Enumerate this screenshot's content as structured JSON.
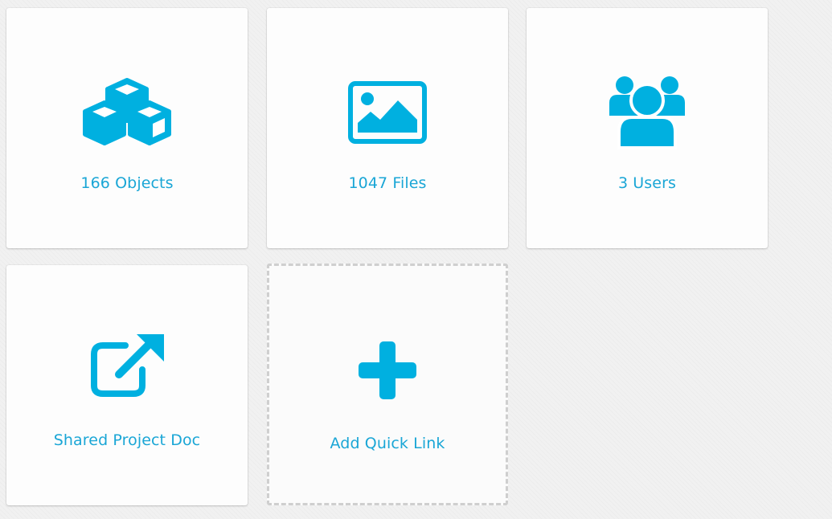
{
  "accent_color": "#00b0e0",
  "label_color": "#1aa6d6",
  "tiles": [
    {
      "icon": "cubes-icon",
      "label": "166 Objects"
    },
    {
      "icon": "image-icon",
      "label": "1047 Files"
    },
    {
      "icon": "users-icon",
      "label": "3 Users"
    },
    {
      "icon": "external-link-icon",
      "label": "Shared Project Doc"
    }
  ],
  "add_tile": {
    "icon": "plus-icon",
    "label": "Add Quick Link"
  }
}
